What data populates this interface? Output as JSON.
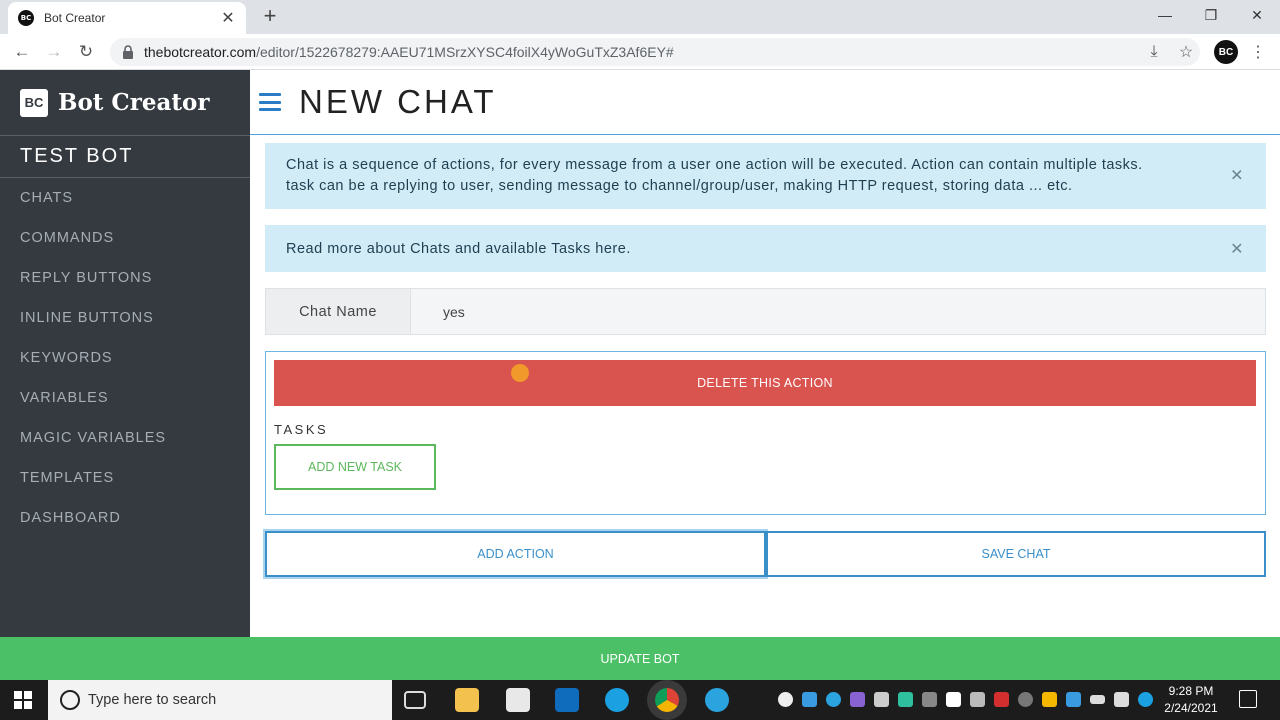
{
  "browser": {
    "tab_title": "Bot Creator",
    "favicon_text": "BC",
    "new_tab_glyph": "+",
    "close_glyph": "✕",
    "url_host": "thebotcreator.com",
    "url_path": "/editor/1522678279:AAEU71MSrzXYSC4foilX4yWoGuTxZ3Af6EY#",
    "profile_text": "BC",
    "window_controls": [
      "—",
      "❐",
      "✕"
    ]
  },
  "sidebar": {
    "logo_text": "BC",
    "brand_name": "Bot Creator",
    "bot_name": "TEST BOT",
    "items": [
      {
        "label": "CHATS"
      },
      {
        "label": "COMMANDS"
      },
      {
        "label": "REPLY BUTTONS"
      },
      {
        "label": "INLINE BUTTONS"
      },
      {
        "label": "KEYWORDS"
      },
      {
        "label": "VARIABLES"
      },
      {
        "label": "MAGIC VARIABLES"
      },
      {
        "label": "TEMPLATES"
      },
      {
        "label": "DASHBOARD"
      }
    ]
  },
  "header": {
    "title": "NEW CHAT"
  },
  "alerts": {
    "info_line1": "Chat is a sequence of actions, for every message from a user one action will be executed. Action can contain multiple tasks.",
    "info_line2": "task can be a replying to user, sending message to channel/group/user, making HTTP request, storing data ... etc.",
    "read_more": "Read more about Chats and available Tasks here.",
    "close_glyph": "✕"
  },
  "form": {
    "chat_name_label": "Chat Name",
    "chat_name_value": "yes"
  },
  "action": {
    "delete_label": "DELETE THIS ACTION",
    "tasks_label": "TASKS",
    "add_task_label": "ADD NEW TASK"
  },
  "buttons": {
    "add_action": "ADD ACTION",
    "save_chat": "SAVE CHAT",
    "update_bot": "UPDATE BOT"
  },
  "taskbar": {
    "search_placeholder": "Type here to search",
    "time": "9:28 PM",
    "date": "2/24/2021"
  },
  "colors": {
    "sidebar_bg": "#343a40",
    "danger": "#d9534f",
    "success": "#5cb85c",
    "primary_outline": "#3a8fc9",
    "update_bar": "#4cc067",
    "alert_bg": "#d1ecf7"
  }
}
